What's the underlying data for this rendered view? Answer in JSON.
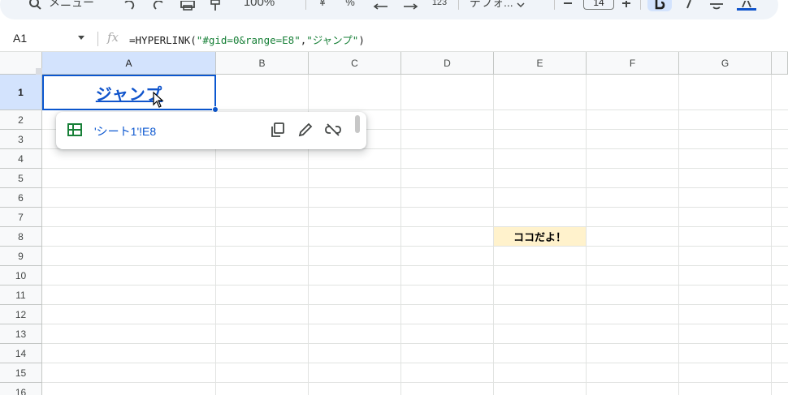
{
  "toolbar": {
    "menu_label": "メニュー",
    "zoom": "100%",
    "currency": "¥",
    "percent": "%",
    "number_format": "123",
    "font_name": "デフォ...",
    "font_size": "14"
  },
  "formula_bar": {
    "name_box": "A1",
    "fx_label": "fx",
    "formula_prefix": "=HYPERLINK(",
    "formula_arg1": "\"#gid=0&range=E8\"",
    "formula_comma": ",",
    "formula_arg2": "\"ジャンプ\"",
    "formula_suffix": ")"
  },
  "columns": [
    "A",
    "B",
    "C",
    "D",
    "E",
    "F",
    "G"
  ],
  "rows": [
    "1",
    "2",
    "3",
    "4",
    "5",
    "6",
    "7",
    "8",
    "9",
    "10",
    "11",
    "12",
    "13",
    "14",
    "15",
    "16"
  ],
  "cells": {
    "A1": "ジャンプ",
    "E8": "ココだよ！"
  },
  "link_popup": {
    "target": "'シート1'!E8"
  },
  "colors": {
    "selection": "#0b57d0",
    "link": "#1155cc",
    "highlight_cell": "#fff2cc",
    "header_selected": "#d3e3fd"
  }
}
